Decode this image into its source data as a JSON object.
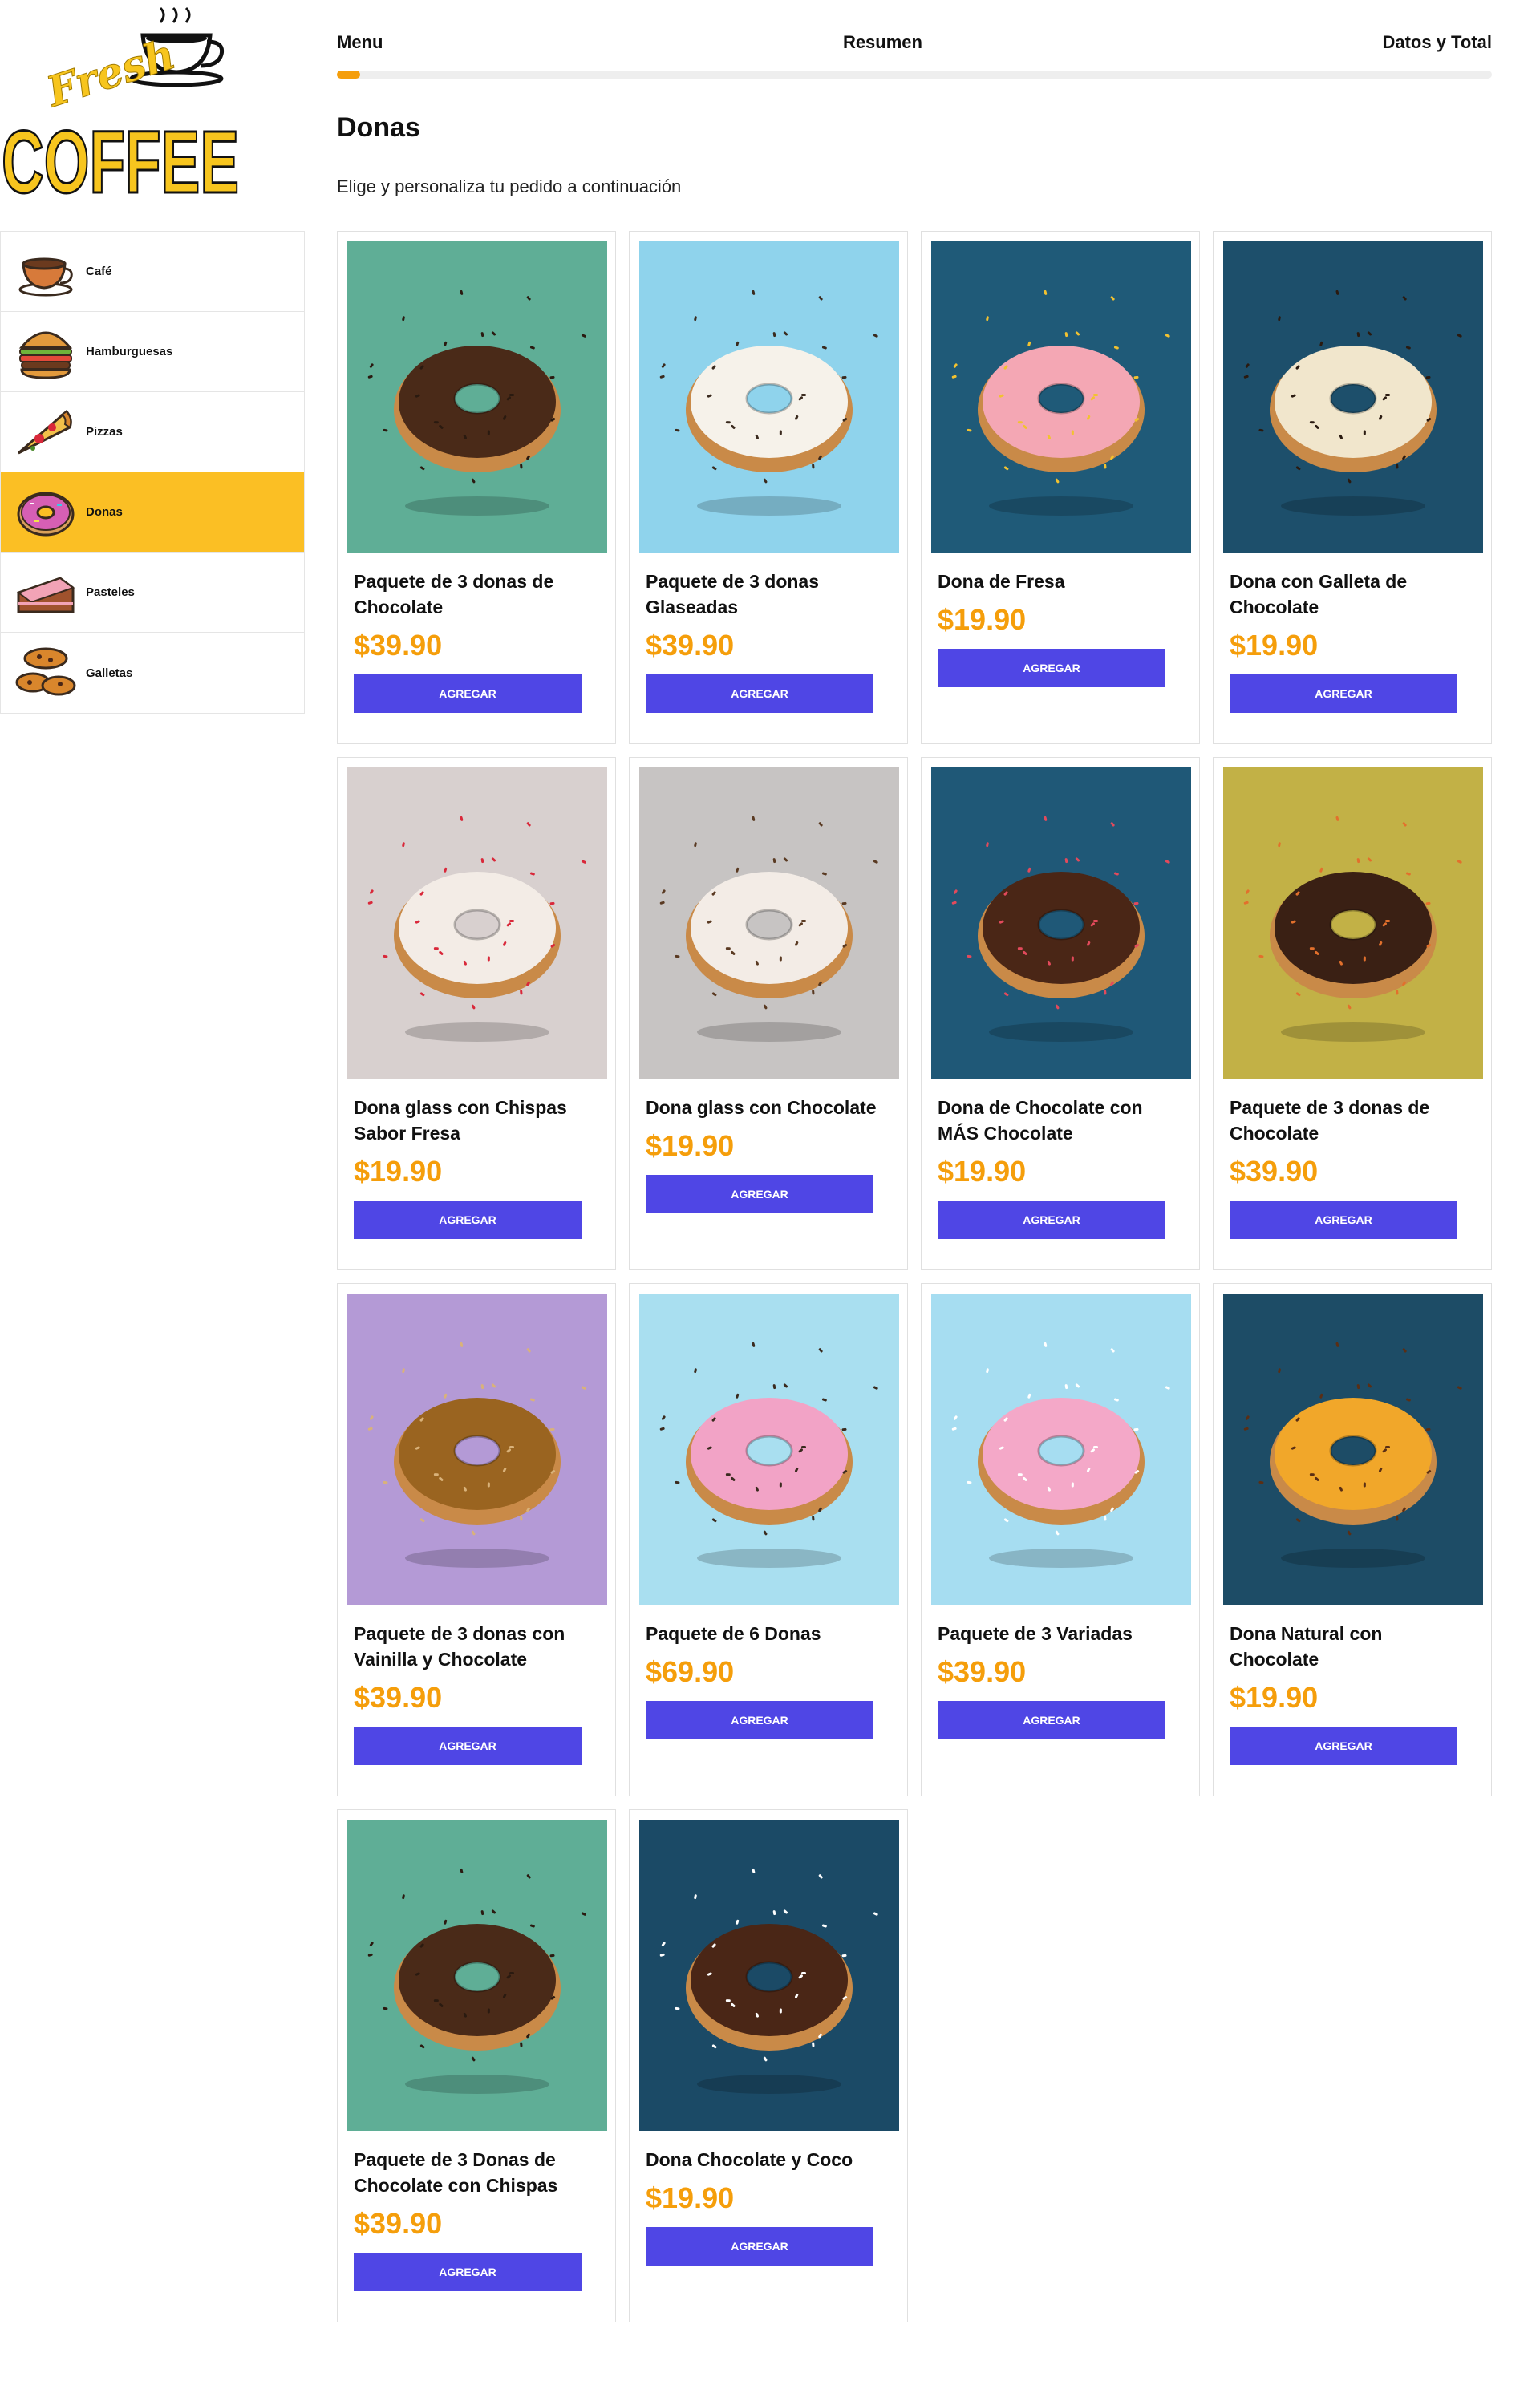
{
  "brand": {
    "script_word": "Fresh",
    "main_word": "COFFEE",
    "color": "#f7c51e"
  },
  "colors": {
    "accent": "#fbbf24",
    "price": "#f59e0b",
    "button": "#4f46e5",
    "progress": "#f59e0b"
  },
  "steps": [
    {
      "label": "Menu"
    },
    {
      "label": "Resumen"
    },
    {
      "label": "Datos y Total"
    }
  ],
  "progress": {
    "percent": 2
  },
  "sidebar": {
    "categories": [
      {
        "label": "Café",
        "icon": "coffee-cup-icon",
        "active": false
      },
      {
        "label": "Hamburguesas",
        "icon": "burger-icon",
        "active": false
      },
      {
        "label": "Pizzas",
        "icon": "pizza-icon",
        "active": false
      },
      {
        "label": "Donas",
        "icon": "donut-icon",
        "active": true
      },
      {
        "label": "Pasteles",
        "icon": "cake-icon",
        "active": false
      },
      {
        "label": "Galletas",
        "icon": "cookies-icon",
        "active": false
      }
    ]
  },
  "main": {
    "title": "Donas",
    "subtitle": "Elige y personaliza tu pedido a continuación",
    "button_label": "Agregar",
    "products": [
      {
        "name": "Paquete de 3 donas de Chocolate",
        "price": "$39.90",
        "bg": "#5fae96",
        "glaze": "#4a2a18",
        "sprinkles": "#2a1a10"
      },
      {
        "name": "Paquete de 3 donas Glaseadas",
        "price": "$39.90",
        "bg": "#8fd3ec",
        "glaze": "#f6f2ea",
        "sprinkles": "#3a2a1e"
      },
      {
        "name": "Dona de Fresa",
        "price": "$19.90",
        "bg": "#1f5a78",
        "glaze": "#f4a7b4",
        "sprinkles": "#f2c230"
      },
      {
        "name": "Dona con Galleta de Chocolate",
        "price": "$19.90",
        "bg": "#1d4f6b",
        "glaze": "#f1e6cc",
        "sprinkles": "#2a1a10"
      },
      {
        "name": "Dona glass con Chispas Sabor Fresa",
        "price": "$19.90",
        "bg": "#d8d0cf",
        "glaze": "#f3ece6",
        "sprinkles": "#d9283a"
      },
      {
        "name": "Dona glass con Chocolate",
        "price": "$19.90",
        "bg": "#c7c4c3",
        "glaze": "#f3ece6",
        "sprinkles": "#5a3a22"
      },
      {
        "name": "Dona de Chocolate con MÁS Chocolate",
        "price": "$19.90",
        "bg": "#1f5877",
        "glaze": "#4a2616",
        "sprinkles": "#e34a5c"
      },
      {
        "name": "Paquete de 3 donas de Chocolate",
        "price": "$39.90",
        "bg": "#c2b146",
        "glaze": "#3a2014",
        "sprinkles": "#e2702c"
      },
      {
        "name": "Paquete de 3 donas con Vainilla y Chocolate",
        "price": "$39.90",
        "bg": "#b49ad6",
        "glaze": "#9a6420",
        "sprinkles": "#d9b27a"
      },
      {
        "name": "Paquete de 6 Donas",
        "price": "$69.90",
        "bg": "#a9dff0",
        "glaze": "#f2a3c6",
        "sprinkles": "#3a2a1e"
      },
      {
        "name": "Paquete de 3 Variadas",
        "price": "$39.90",
        "bg": "#a6ddf1",
        "glaze": "#f4a8c8",
        "sprinkles": "#ffffff"
      },
      {
        "name": "Dona Natural con Chocolate",
        "price": "$19.90",
        "bg": "#1d4c66",
        "glaze": "#f1a72a",
        "sprinkles": "#5a2e14"
      },
      {
        "name": "Paquete de 3 Donas de Chocolate con Chispas",
        "price": "$39.90",
        "bg": "#5fae96",
        "glaze": "#4a2a18",
        "sprinkles": "#2a1a10"
      },
      {
        "name": "Dona Chocolate y Coco",
        "price": "$19.90",
        "bg": "#1b4a66",
        "glaze": "#4a2616",
        "sprinkles": "#ffffff"
      }
    ]
  }
}
